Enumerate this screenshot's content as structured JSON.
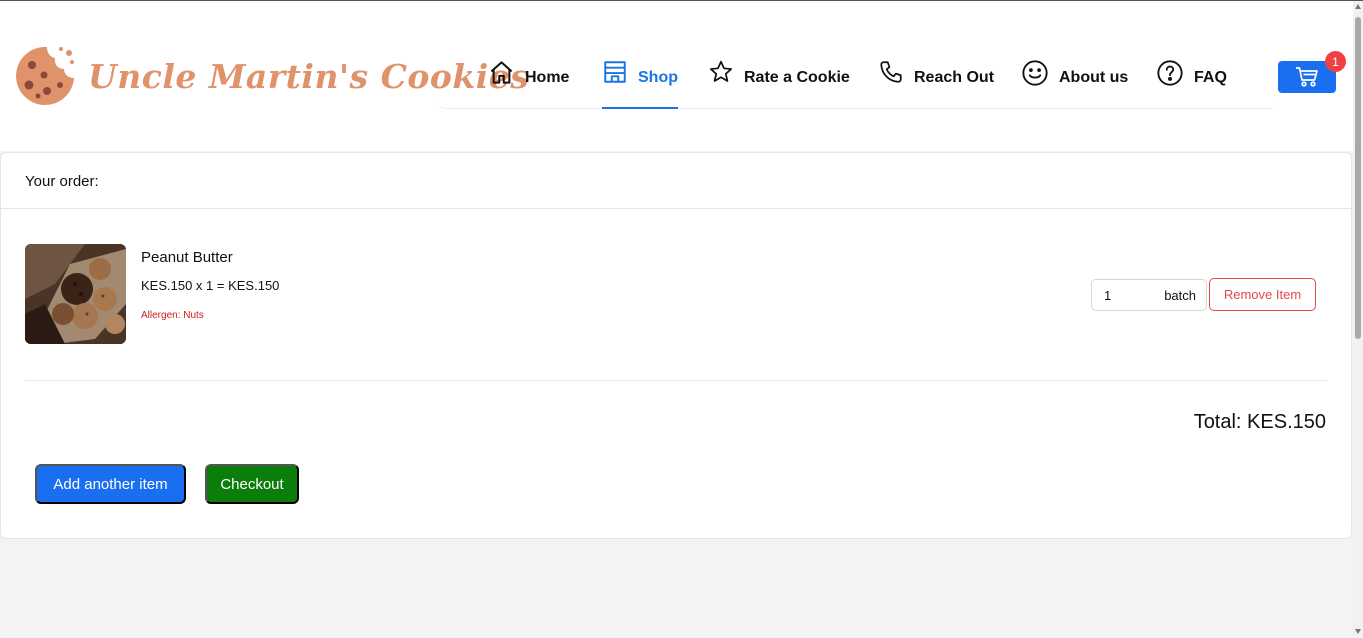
{
  "brand": {
    "name": "Uncle Martin's Cookies",
    "color": "#e0926a"
  },
  "nav": {
    "items": [
      {
        "label": "Home",
        "icon": "home-icon",
        "active": false
      },
      {
        "label": "Shop",
        "icon": "shop-icon",
        "active": true
      },
      {
        "label": "Rate a Cookie",
        "icon": "star-icon",
        "active": false
      },
      {
        "label": "Reach Out",
        "icon": "phone-icon",
        "active": false
      },
      {
        "label": "About us",
        "icon": "smile-icon",
        "active": false
      },
      {
        "label": "FAQ",
        "icon": "question-icon",
        "active": false
      }
    ],
    "active_color": "#1a73e8"
  },
  "cart": {
    "icon": "cart-icon",
    "count": "1"
  },
  "order": {
    "heading": "Your order:",
    "items": [
      {
        "name": "Peanut Butter",
        "price_line": "KES.150 x 1 = KES.150",
        "allergen": "Allergen: Nuts",
        "quantity": "1",
        "unit": "batch",
        "remove_label": "Remove Item"
      }
    ],
    "total": "Total: KES.150"
  },
  "actions": {
    "add_label": "Add another item",
    "checkout_label": "Checkout"
  },
  "colors": {
    "primary": "#1a6ff0",
    "checkout": "#0b7d0b",
    "danger": "#e04a4a",
    "badge": "#ef4044"
  }
}
